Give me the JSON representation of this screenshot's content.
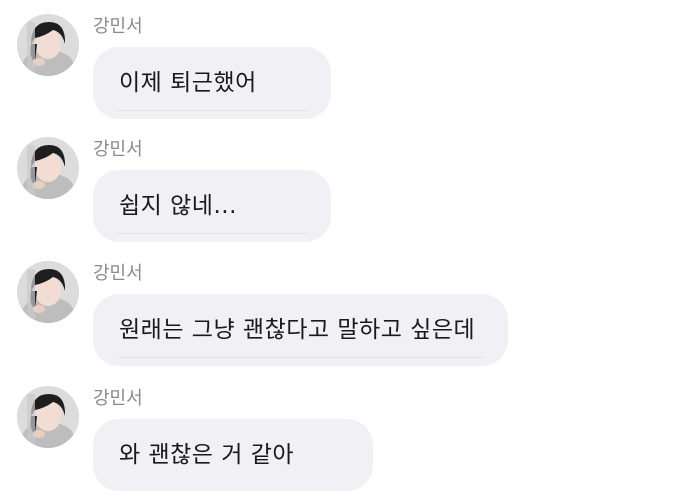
{
  "chat": {
    "messages": [
      {
        "sender": "강민서",
        "text": "이제 퇴근했어"
      },
      {
        "sender": "강민서",
        "text": "쉽지 않네..."
      },
      {
        "sender": "강민서",
        "text": "원래는 그냥 괜찮다고 말하고 싶은데"
      },
      {
        "sender": "강민서",
        "text": "와 괜찮은 거 같아"
      }
    ]
  },
  "colors": {
    "bubble": "#f0f0f5",
    "sender_name": "#8a8a8a",
    "message_text": "#1a1a1a"
  }
}
